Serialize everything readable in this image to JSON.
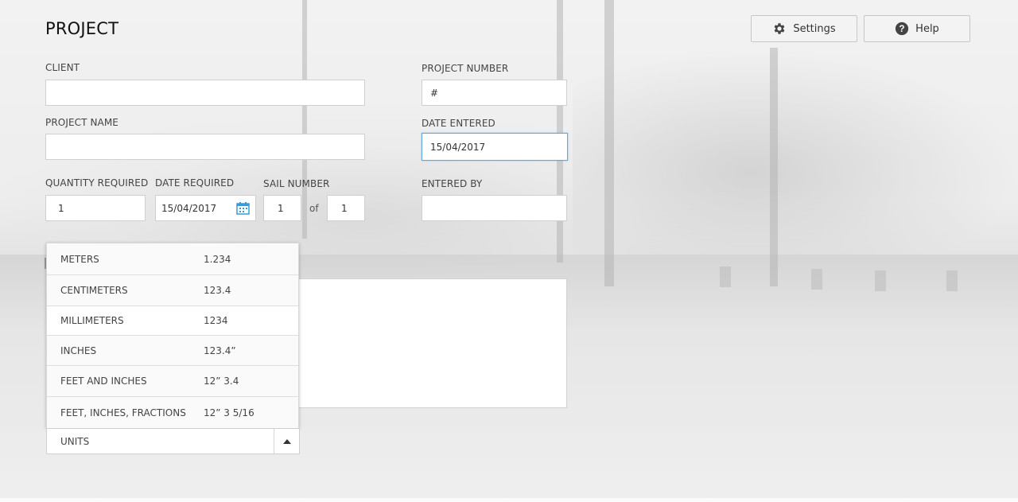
{
  "header": {
    "title": "PROJECT",
    "settings_label": "Settings",
    "help_label": "Help"
  },
  "form": {
    "client": {
      "label": "CLIENT",
      "value": ""
    },
    "project_number": {
      "label": "PROJECT NUMBER",
      "value": "#"
    },
    "project_name": {
      "label": "PROJECT NAME",
      "value": ""
    },
    "date_entered": {
      "label": "DATE ENTERED",
      "value": "15/04/2017"
    },
    "quantity_required": {
      "label": "QUANTITY REQUIRED",
      "value": "1"
    },
    "date_required": {
      "label": "DATE REQUIRED",
      "value": "15/04/2017"
    },
    "sail_number": {
      "label": "SAIL NUMBER",
      "value": "1",
      "of_text": "of",
      "total": "1"
    },
    "entered_by": {
      "label": "ENTERED BY",
      "value": ""
    }
  },
  "units": {
    "selected": "UNITS",
    "options": [
      {
        "name": "METERS",
        "example": "1.234"
      },
      {
        "name": "CENTIMETERS",
        "example": "123.4"
      },
      {
        "name": "MILLIMETERS",
        "example": "1234"
      },
      {
        "name": "INCHES",
        "example": "123.4”"
      },
      {
        "name": "FEET AND INCHES",
        "example": "12” 3.4"
      },
      {
        "name": "FEET, INCHES, FRACTIONS",
        "example": "12” 3 5/16"
      }
    ]
  },
  "colors": {
    "accent": "#5aa9e6",
    "calendar_icon": "#3a9ad9"
  }
}
